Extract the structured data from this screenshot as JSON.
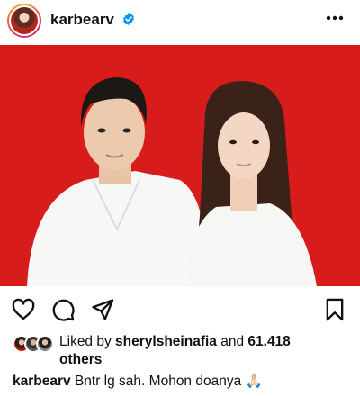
{
  "post": {
    "username": "karbearv",
    "verified": true
  },
  "likes": {
    "prefix": "Liked by ",
    "user": "sherylsheinafia",
    "middle": " and ",
    "count": "61.418",
    "suffix": "others"
  },
  "caption": {
    "username": "karbearv",
    "text": "Bntr lg sah. Mohon doanya",
    "emoji": "🙏🏻"
  },
  "colors": {
    "photo_background": "#d81b1b",
    "verified_badge": "#0095f6",
    "icon_stroke": "#111111"
  },
  "icons": [
    "verified-badge-icon",
    "more-options-icon",
    "heart-icon",
    "comment-icon",
    "share-icon",
    "bookmark-icon"
  ]
}
